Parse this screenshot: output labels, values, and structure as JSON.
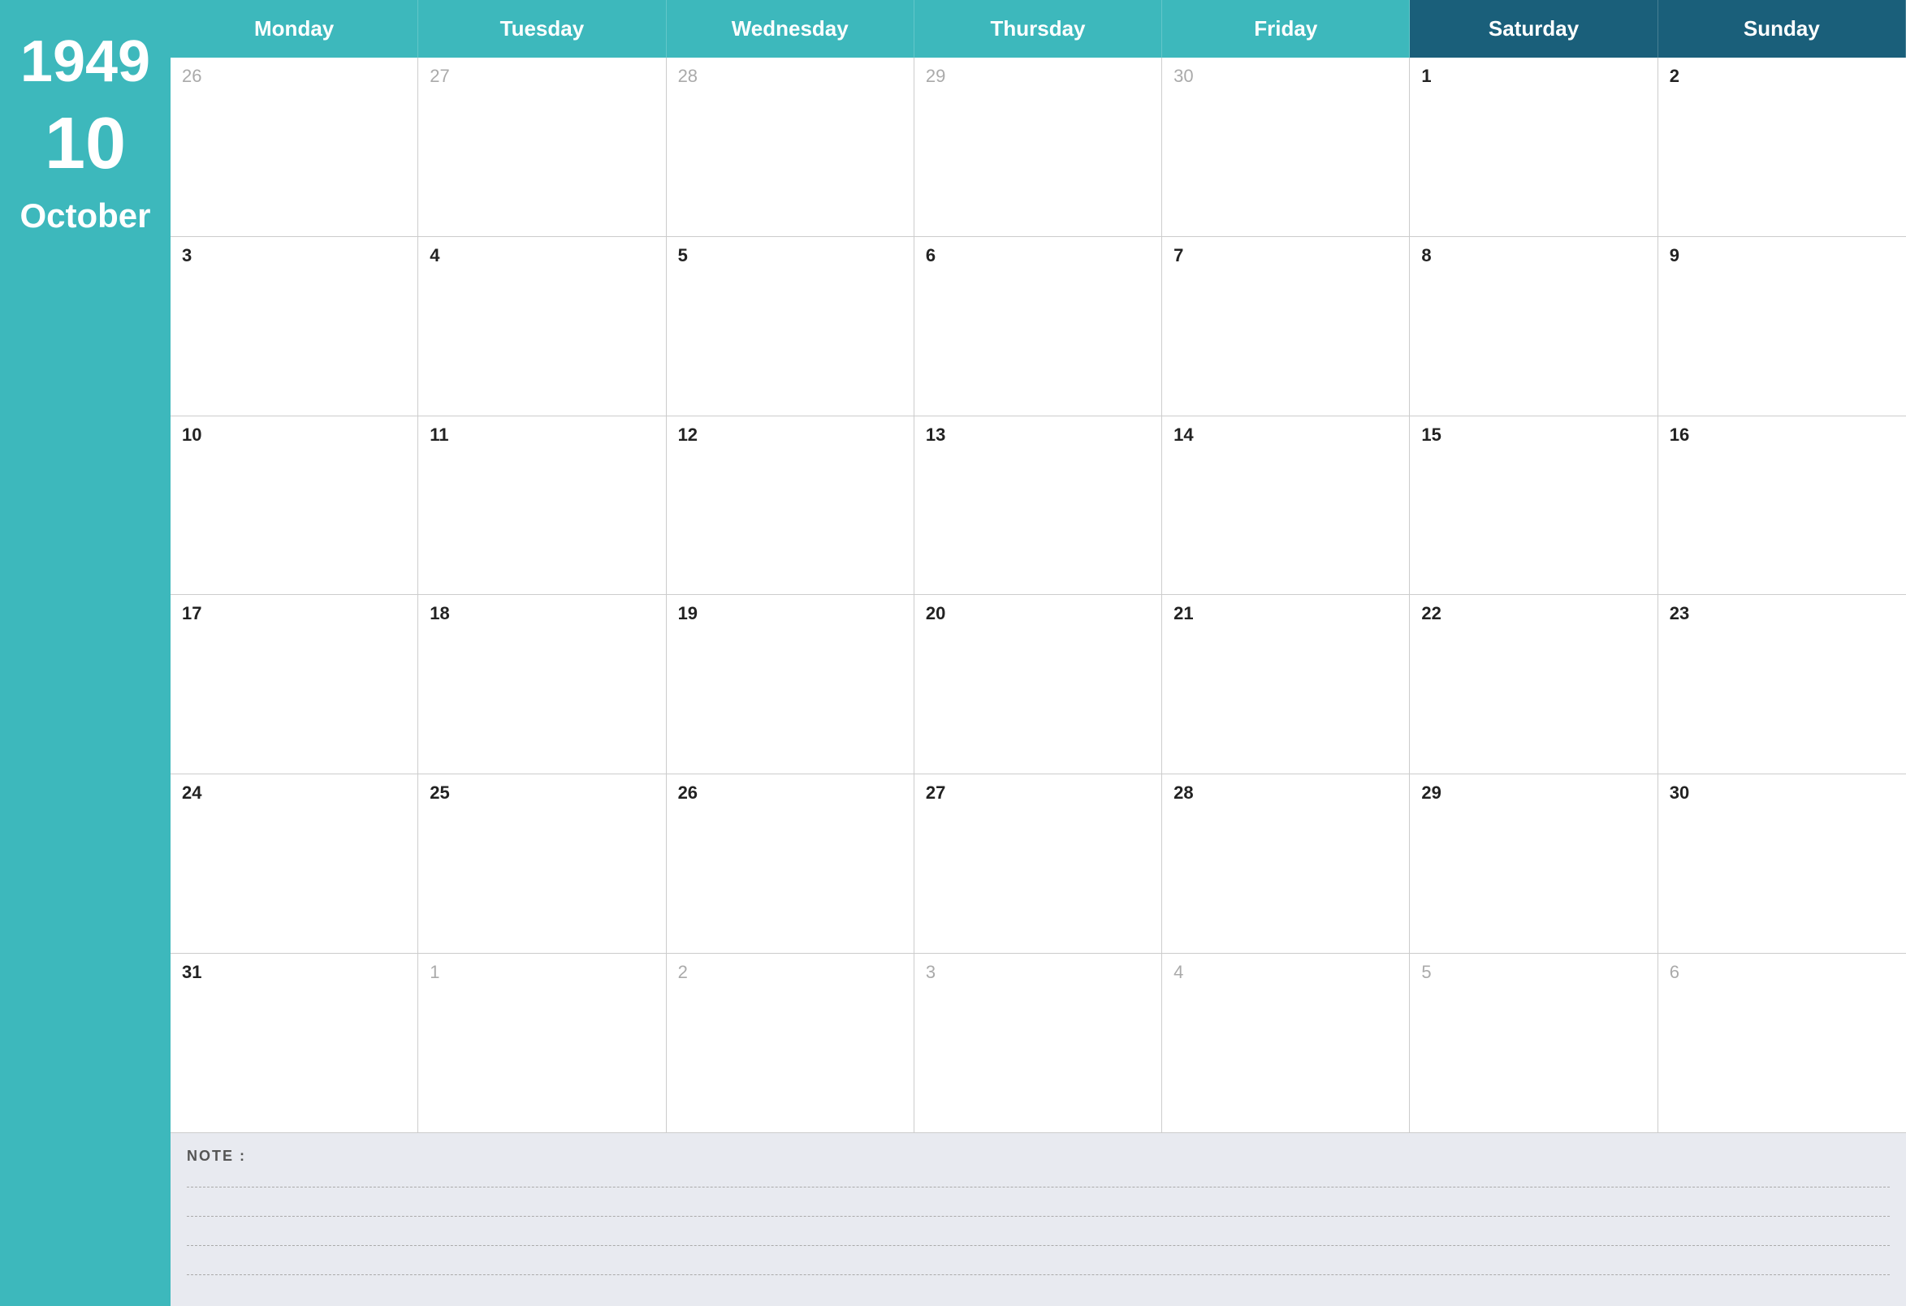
{
  "sidebar": {
    "year": "1949",
    "month_number": "10",
    "month_name": "October"
  },
  "headers": [
    {
      "label": "Monday",
      "day_class": "weekday"
    },
    {
      "label": "Tuesday",
      "day_class": "weekday"
    },
    {
      "label": "Wednesday",
      "day_class": "weekday"
    },
    {
      "label": "Thursday",
      "day_class": "weekday"
    },
    {
      "label": "Friday",
      "day_class": "weekday"
    },
    {
      "label": "Saturday",
      "day_class": "saturday"
    },
    {
      "label": "Sunday",
      "day_class": "sunday"
    }
  ],
  "weeks": [
    {
      "days": [
        {
          "number": "26",
          "type": "other-month"
        },
        {
          "number": "27",
          "type": "other-month"
        },
        {
          "number": "28",
          "type": "other-month"
        },
        {
          "number": "29",
          "type": "other-month"
        },
        {
          "number": "30",
          "type": "other-month"
        },
        {
          "number": "1",
          "type": "current"
        },
        {
          "number": "2",
          "type": "current"
        }
      ]
    },
    {
      "days": [
        {
          "number": "3",
          "type": "current"
        },
        {
          "number": "4",
          "type": "current"
        },
        {
          "number": "5",
          "type": "current"
        },
        {
          "number": "6",
          "type": "current"
        },
        {
          "number": "7",
          "type": "current"
        },
        {
          "number": "8",
          "type": "current"
        },
        {
          "number": "9",
          "type": "current"
        }
      ]
    },
    {
      "days": [
        {
          "number": "10",
          "type": "current"
        },
        {
          "number": "11",
          "type": "current"
        },
        {
          "number": "12",
          "type": "current"
        },
        {
          "number": "13",
          "type": "current"
        },
        {
          "number": "14",
          "type": "current"
        },
        {
          "number": "15",
          "type": "current"
        },
        {
          "number": "16",
          "type": "current"
        }
      ]
    },
    {
      "days": [
        {
          "number": "17",
          "type": "current"
        },
        {
          "number": "18",
          "type": "current"
        },
        {
          "number": "19",
          "type": "current"
        },
        {
          "number": "20",
          "type": "current"
        },
        {
          "number": "21",
          "type": "current"
        },
        {
          "number": "22",
          "type": "current"
        },
        {
          "number": "23",
          "type": "current"
        }
      ]
    },
    {
      "days": [
        {
          "number": "24",
          "type": "current"
        },
        {
          "number": "25",
          "type": "current"
        },
        {
          "number": "26",
          "type": "current"
        },
        {
          "number": "27",
          "type": "current"
        },
        {
          "number": "28",
          "type": "current"
        },
        {
          "number": "29",
          "type": "current"
        },
        {
          "number": "30",
          "type": "current"
        }
      ]
    },
    {
      "days": [
        {
          "number": "31",
          "type": "current"
        },
        {
          "number": "1",
          "type": "other-month"
        },
        {
          "number": "2",
          "type": "other-month"
        },
        {
          "number": "3",
          "type": "other-month"
        },
        {
          "number": "4",
          "type": "other-month"
        },
        {
          "number": "5",
          "type": "other-month"
        },
        {
          "number": "6",
          "type": "other-month"
        }
      ]
    }
  ],
  "notes": {
    "label": "NOTE :",
    "lines": [
      "",
      "",
      "",
      ""
    ]
  },
  "colors": {
    "teal": "#3db8bc",
    "dark_blue": "#1a5f7a",
    "background": "#e8eaf0",
    "cell_bg": "#ffffff",
    "border": "#cccccc",
    "text_current": "#222222",
    "text_other": "#aaaaaa"
  }
}
